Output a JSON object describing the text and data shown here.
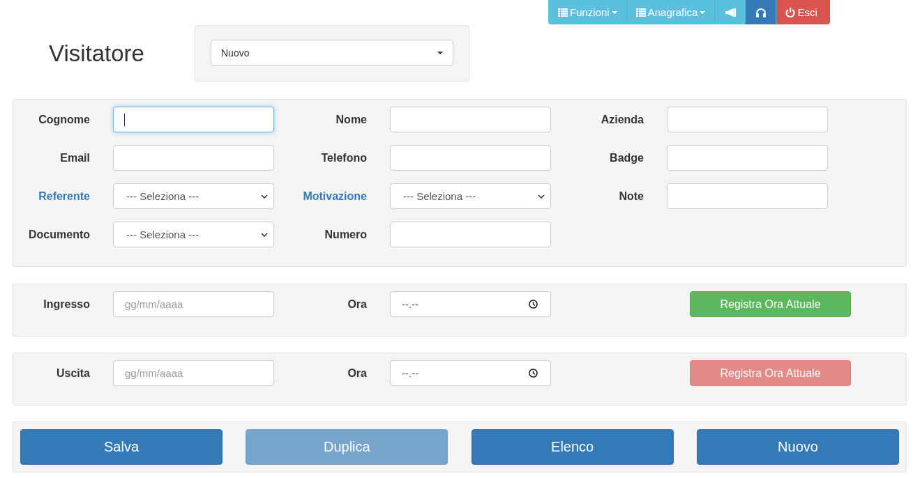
{
  "nav": [
    {
      "kind": "menu",
      "label": "Funzioni",
      "selected": false
    },
    {
      "kind": "menu",
      "label": "Anagrafica",
      "selected": false
    },
    {
      "kind": "megaphone",
      "selected": false
    },
    {
      "kind": "headphones",
      "selected": true
    },
    {
      "kind": "logout",
      "label": "Esci",
      "selected": false
    }
  ],
  "title": "Visitatore",
  "mode_select": {
    "value": "Nuovo"
  },
  "fields": [
    {
      "label": "Cognome",
      "kind": "text",
      "link": false,
      "focused": true
    },
    {
      "label": "Nome",
      "kind": "text",
      "link": false,
      "focused": false
    },
    {
      "label": "Azienda",
      "kind": "text",
      "link": false,
      "focused": false
    },
    {
      "label": "Email",
      "kind": "text",
      "link": false,
      "focused": false
    },
    {
      "label": "Telefono",
      "kind": "text",
      "link": false,
      "focused": false
    },
    {
      "label": "Badge",
      "kind": "text",
      "link": false,
      "focused": false
    },
    {
      "label": "Referente",
      "kind": "select",
      "link": true,
      "value": "--- Seleziona ---",
      "focused": false
    },
    {
      "label": "Motivazione",
      "kind": "select",
      "link": true,
      "value": "--- Seleziona ---",
      "focused": false
    },
    {
      "label": "Note",
      "kind": "text",
      "link": false,
      "focused": false
    },
    {
      "label": "Documento",
      "kind": "select",
      "link": false,
      "value": "--- Seleziona ---",
      "focused": false
    },
    {
      "label": "Numero",
      "kind": "text",
      "link": false,
      "focused": false
    }
  ],
  "time_sections": [
    {
      "kind": "entry",
      "label": "Ingresso",
      "date_placeholder": "gg/mm/aaaa",
      "time_label": "Ora",
      "time_value": "--.--",
      "button": {
        "label": "Registra Ora Attuale",
        "disabled": false
      }
    },
    {
      "kind": "exit",
      "label": "Uscita",
      "date_placeholder": "gg/mm/aaaa",
      "time_label": "Ora",
      "time_value": "--.--",
      "button": {
        "label": "Registra Ora Attuale",
        "disabled": true
      }
    }
  ],
  "actions": [
    {
      "label": "Salva",
      "disabled": false
    },
    {
      "label": "Duplica",
      "disabled": true
    },
    {
      "label": "Elenco",
      "disabled": false
    },
    {
      "label": "Nuovo",
      "disabled": false
    }
  ]
}
